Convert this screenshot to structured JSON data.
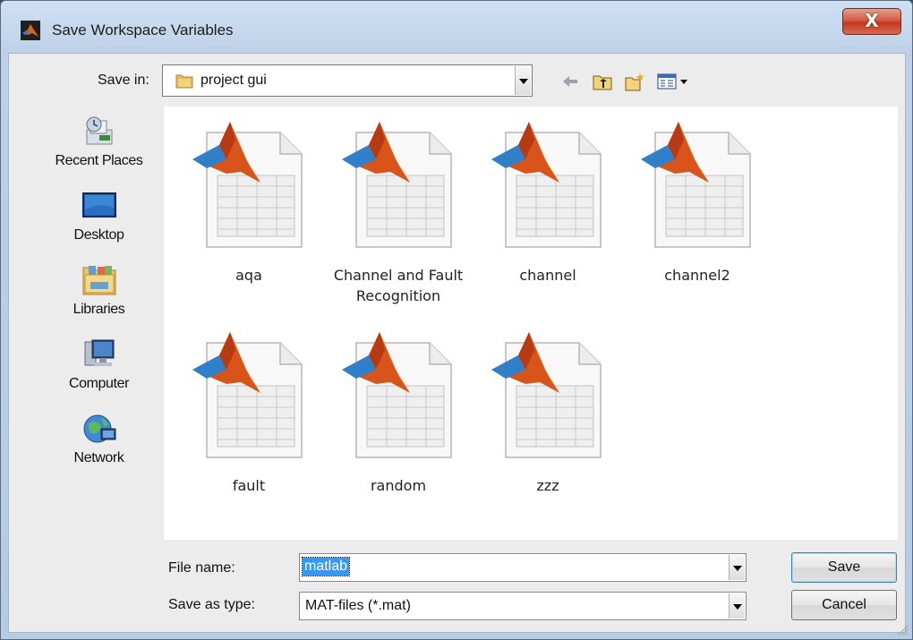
{
  "window": {
    "title": "Save Workspace Variables",
    "close_label": "X"
  },
  "toolbar": {
    "save_in_label": "Save in:",
    "folder": "project gui",
    "icons": [
      "back-arrow-icon",
      "up-folder-icon",
      "new-folder-icon",
      "view-menu-icon"
    ]
  },
  "places": [
    {
      "label": "Recent Places",
      "icon": "recent-places-icon"
    },
    {
      "label": "Desktop",
      "icon": "desktop-icon"
    },
    {
      "label": "Libraries",
      "icon": "libraries-icon"
    },
    {
      "label": "Computer",
      "icon": "computer-icon"
    },
    {
      "label": "Network",
      "icon": "network-icon"
    }
  ],
  "files": [
    {
      "name": "aqa"
    },
    {
      "name": "Channel and Fault Recognition"
    },
    {
      "name": "channel"
    },
    {
      "name": "channel2"
    },
    {
      "name": "fault"
    },
    {
      "name": "random"
    },
    {
      "name": "zzz"
    }
  ],
  "form": {
    "file_name_label": "File name:",
    "file_name_value": "matlab",
    "save_type_label": "Save as type:",
    "save_type_value": "MAT-files (*.mat)"
  },
  "buttons": {
    "save": "Save",
    "cancel": "Cancel"
  }
}
